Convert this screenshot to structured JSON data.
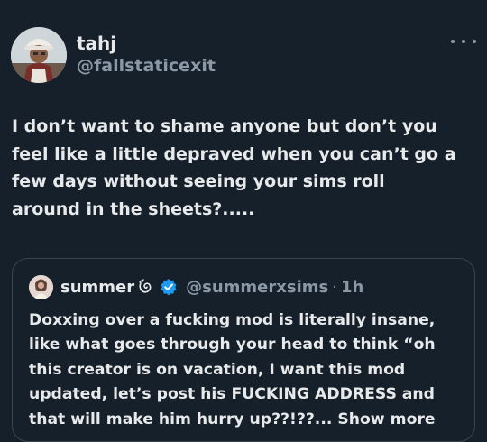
{
  "author": {
    "display_name": "tahj",
    "handle": "@fallstaticexit"
  },
  "more_menu": {
    "icon": "more-horizontal-icon"
  },
  "tweet": {
    "text": "I don’t want to shame anyone but don’t you\nfeel like a little depraved when you can’t go a\nfew days without seeing your sims roll\naround in the sheets?....."
  },
  "quoted": {
    "display_name": "summer",
    "emoji_icon": "shell-emoji-icon",
    "verified_icon": "verified-badge-icon",
    "handle": "@summerxsims",
    "dot": "·",
    "time": "1h",
    "text": "Doxxing over a fucking mod is literally insane,\nlike what goes through your head to think “oh\nthis creator is on vacation, I want this mod\nupdated, let’s post his FUCKING ADDRESS and\nthat will make him hurry up??!??... ",
    "show_more": "Show more"
  },
  "colors": {
    "background": "#15202b",
    "text": "#e7e9ea",
    "muted": "#8b98a5",
    "verified": "#1d9bf0",
    "border": "#3a4550"
  }
}
